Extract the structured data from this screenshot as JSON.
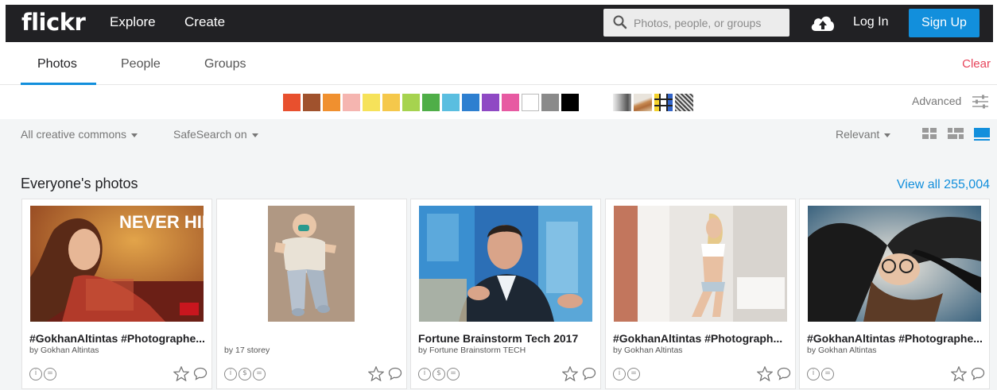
{
  "header": {
    "logo": "flickr",
    "nav": [
      "Explore",
      "Create"
    ],
    "search_placeholder": "Photos, people, or groups",
    "login": "Log In",
    "signup": "Sign Up"
  },
  "tabs": {
    "items": [
      "Photos",
      "People",
      "Groups"
    ],
    "active": "Photos",
    "clear": "Clear"
  },
  "color_filters": [
    "#e8502e",
    "#a0522d",
    "#f0902f",
    "#f5b5b0",
    "#f6e25a",
    "#f5c84b",
    "#a6d34f",
    "#4fae48",
    "#5abee0",
    "#2d7fd0",
    "#8f49c4",
    "#e75aa2",
    "#ffffff",
    "#8a8a8a",
    "#000000"
  ],
  "style_filters": [
    "black-white",
    "shallow-depth",
    "minimalist",
    "patterns"
  ],
  "advanced_label": "Advanced",
  "filters": {
    "license": "All creative commons",
    "safesearch": "SafeSearch on",
    "sort": "Relevant"
  },
  "section": {
    "title": "Everyone's photos",
    "view_all": "View all 255,004"
  },
  "photos": [
    {
      "title": "#GokhanAltintas #Photographe...",
      "by": "by Gokhan Altintas",
      "overlay": "NEVER HIDE",
      "licenses": [
        "attribution",
        "no-derivs"
      ]
    },
    {
      "title": "",
      "by": "by 17 storey",
      "licenses": [
        "attribution",
        "non-commercial",
        "no-derivs"
      ]
    },
    {
      "title": "Fortune Brainstorm Tech 2017",
      "by": "by Fortune Brainstorm TECH",
      "licenses": [
        "attribution",
        "non-commercial",
        "no-derivs"
      ]
    },
    {
      "title": "#GokhanAltintas #Photograph...",
      "by": "by Gokhan Altintas",
      "licenses": [
        "attribution",
        "no-derivs"
      ]
    },
    {
      "title": "#GokhanAltintas #Photographe...",
      "by": "by Gokhan Altintas",
      "licenses": [
        "attribution",
        "no-derivs"
      ]
    }
  ],
  "colors": {
    "topbar": "#212124",
    "accent": "#128fdc",
    "clear": "#e7455b"
  }
}
